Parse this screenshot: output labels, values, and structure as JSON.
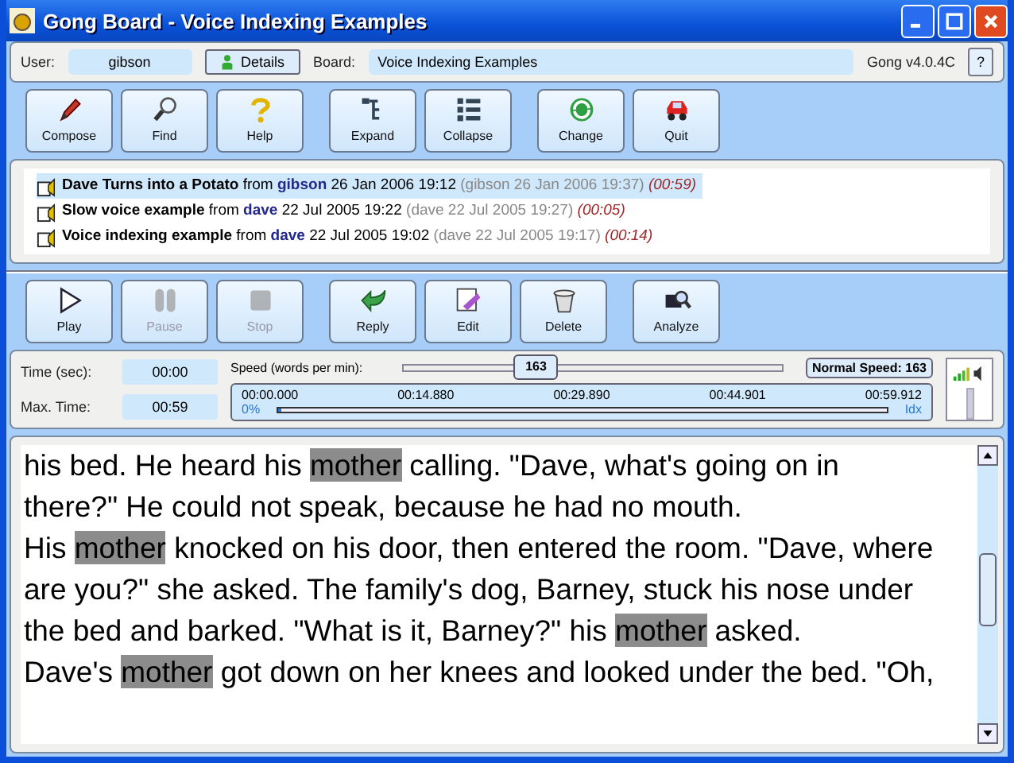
{
  "window": {
    "title": "Gong Board - Voice Indexing Examples"
  },
  "user_bar": {
    "user_label": "User:",
    "user": "gibson",
    "details_button": "Details",
    "board_label": "Board:",
    "board": "Voice Indexing Examples",
    "version": "Gong v4.0.4C",
    "help_button": "?"
  },
  "main_toolbar": [
    {
      "label": "Compose",
      "disabled": false
    },
    {
      "label": "Find",
      "disabled": false
    },
    {
      "label": "Help",
      "disabled": false
    },
    {
      "label": "Expand",
      "disabled": false
    },
    {
      "label": "Collapse",
      "disabled": false
    },
    {
      "label": "Change",
      "disabled": false
    },
    {
      "label": "Quit",
      "disabled": false
    }
  ],
  "messages": [
    {
      "subject": "Dave Turns into a Potato",
      "from_word": "from",
      "author": "gibson",
      "date": "26 Jan 2006 19:12",
      "edited": "(gibson 26 Jan 2006 19:37)",
      "duration": "(00:59)",
      "selected": true
    },
    {
      "subject": "Slow voice example",
      "from_word": "from",
      "author": "dave",
      "date": "22 Jul 2005 19:22",
      "edited": "(dave 22 Jul 2005 19:27)",
      "duration": "(00:05)",
      "selected": false
    },
    {
      "subject": "Voice indexing example",
      "from_word": "from",
      "author": "dave",
      "date": "22 Jul 2005 19:02",
      "edited": "(dave 22 Jul 2005 19:17)",
      "duration": "(00:14)",
      "selected": false
    }
  ],
  "player_toolbar": [
    {
      "label": "Play",
      "disabled": false
    },
    {
      "label": "Pause",
      "disabled": true
    },
    {
      "label": "Stop",
      "disabled": true
    },
    {
      "label": "Reply",
      "disabled": false
    },
    {
      "label": "Edit",
      "disabled": false
    },
    {
      "label": "Delete",
      "disabled": false
    },
    {
      "label": "Analyze",
      "disabled": false
    }
  ],
  "player": {
    "time_label": "Time (sec):",
    "time": "00:00",
    "max_label": "Max. Time:",
    "max_time": "00:59",
    "speed_label": "Speed (words per min):",
    "speed": {
      "value": "163",
      "level": 0.35
    },
    "normal_speed_button": "Normal Speed: 163",
    "timeline_ticks": [
      "00:00.000",
      "00:14.880",
      "00:29.890",
      "00:44.901",
      "00:59.912"
    ],
    "progress": {
      "percent": "0%",
      "level": 0,
      "end_label": "Idx"
    }
  },
  "transcript": [
    [
      {
        "text": "his bed. He heard his ",
        "highlighted": false
      },
      {
        "text": "mother",
        "highlighted": true
      },
      {
        "text": " calling. \"Dave, what's going on in",
        "highlighted": false
      }
    ],
    [
      {
        "text": "there?\" He could not speak, because he had no mouth.",
        "highlighted": false
      }
    ],
    [
      {
        "text": "His ",
        "highlighted": false
      },
      {
        "text": "mother",
        "highlighted": true
      },
      {
        "text": " knocked on his door, then entered the room. \"Dave, where",
        "highlighted": false
      }
    ],
    [
      {
        "text": "are you?\" she asked. The family's dog, Barney, stuck his nose under",
        "highlighted": false
      }
    ],
    [
      {
        "text": "the bed and barked. \"What is it, Barney?\" his ",
        "highlighted": false
      },
      {
        "text": "mother",
        "highlighted": true
      },
      {
        "text": " asked.",
        "highlighted": false
      }
    ],
    [
      {
        "text": "Dave's ",
        "highlighted": false
      },
      {
        "text": "mother",
        "highlighted": true
      },
      {
        "text": " got down on her knees and looked under the bed. \"Oh,",
        "highlighted": false
      }
    ]
  ]
}
